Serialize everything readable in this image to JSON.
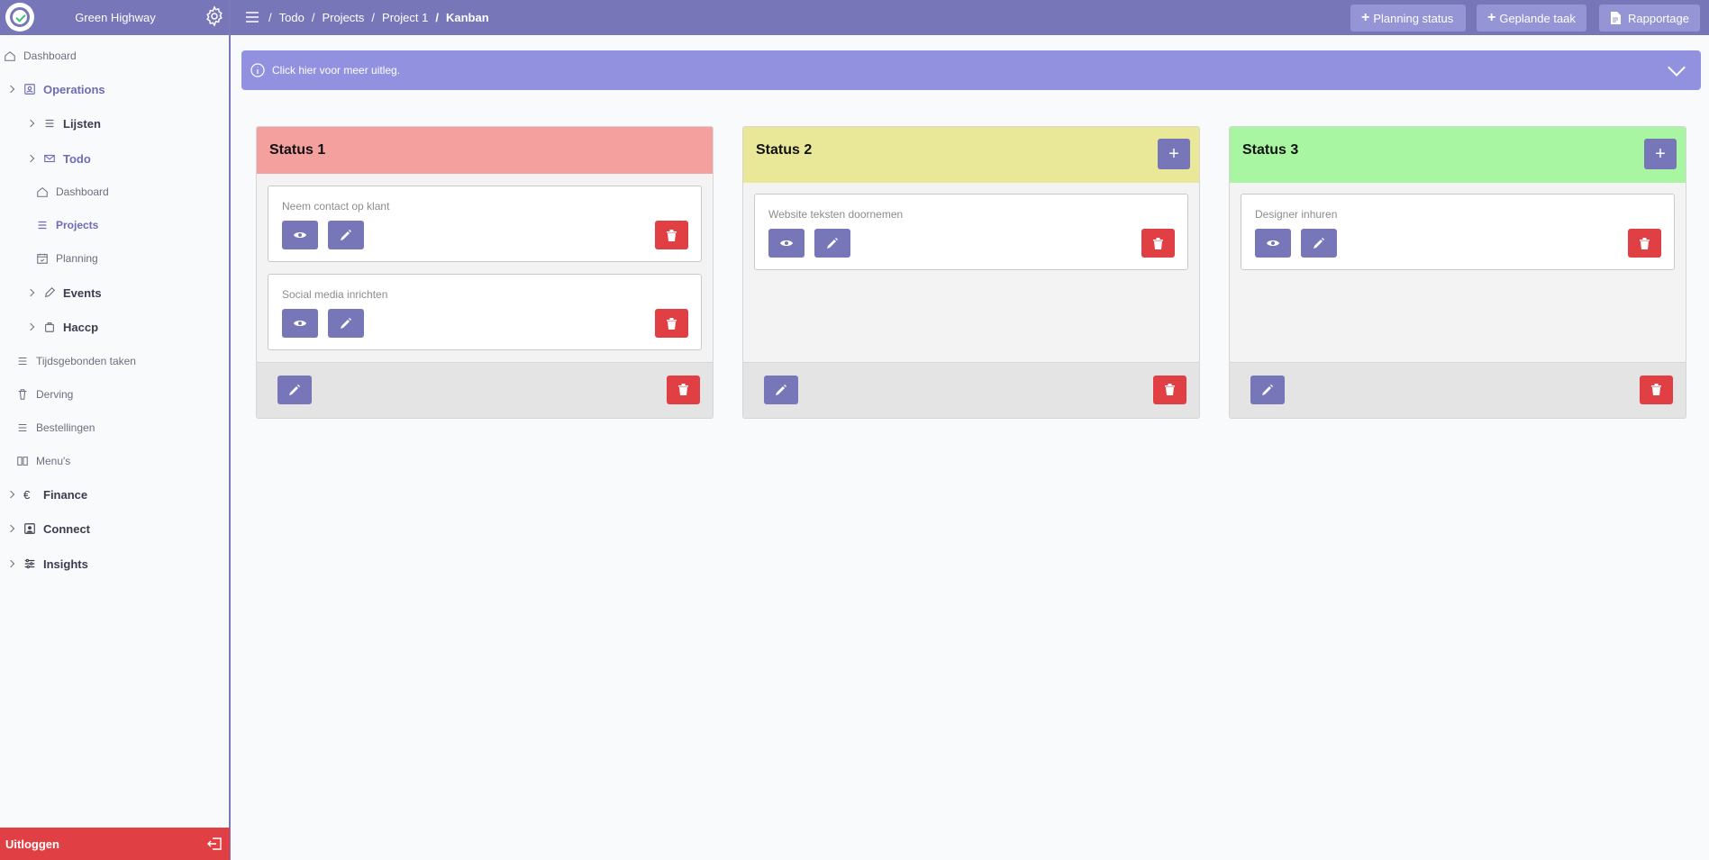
{
  "app": {
    "brand": "Green Highway"
  },
  "topbar": {
    "breadcrumbs": [
      "/",
      "Todo",
      "/",
      "Projects",
      "/",
      "Project 1",
      "/",
      "Kanban"
    ],
    "buttons": {
      "planning_status": "Planning status",
      "geplande_taak": "Geplande taak",
      "rapportage": "Rapportage"
    }
  },
  "sidebar": {
    "items": [
      {
        "label": "Dashboard"
      },
      {
        "label": "Operations"
      },
      {
        "label": "Lijsten"
      },
      {
        "label": "Todo"
      },
      {
        "label": "Dashboard"
      },
      {
        "label": "Projects"
      },
      {
        "label": "Planning"
      },
      {
        "label": "Events"
      },
      {
        "label": "Haccp"
      },
      {
        "label": "Tijdsgebonden taken"
      },
      {
        "label": "Derving"
      },
      {
        "label": "Bestellingen"
      },
      {
        "label": "Menu's"
      },
      {
        "label": "Finance"
      },
      {
        "label": "Connect"
      },
      {
        "label": "Insights"
      }
    ],
    "logout": "Uitloggen"
  },
  "info": {
    "text": "Click hier voor meer uitleg."
  },
  "kanban": {
    "columns": [
      {
        "title": "Status 1",
        "color": "#f4a09f",
        "cards": [
          {
            "title": "Neem contact op klant"
          },
          {
            "title": "Social media inrichten"
          }
        ]
      },
      {
        "title": "Status 2",
        "color": "#e8e898",
        "cards": [
          {
            "title": "Website teksten doornemen"
          }
        ]
      },
      {
        "title": "Status 3",
        "color": "#a9f6a2",
        "cards": [
          {
            "title": "Designer inhuren"
          }
        ]
      }
    ]
  },
  "icons": {
    "add": "+",
    "euro": "€"
  },
  "colors": {
    "primary": "#7776b9",
    "danger": "#e04043",
    "info": "#9291e0"
  }
}
